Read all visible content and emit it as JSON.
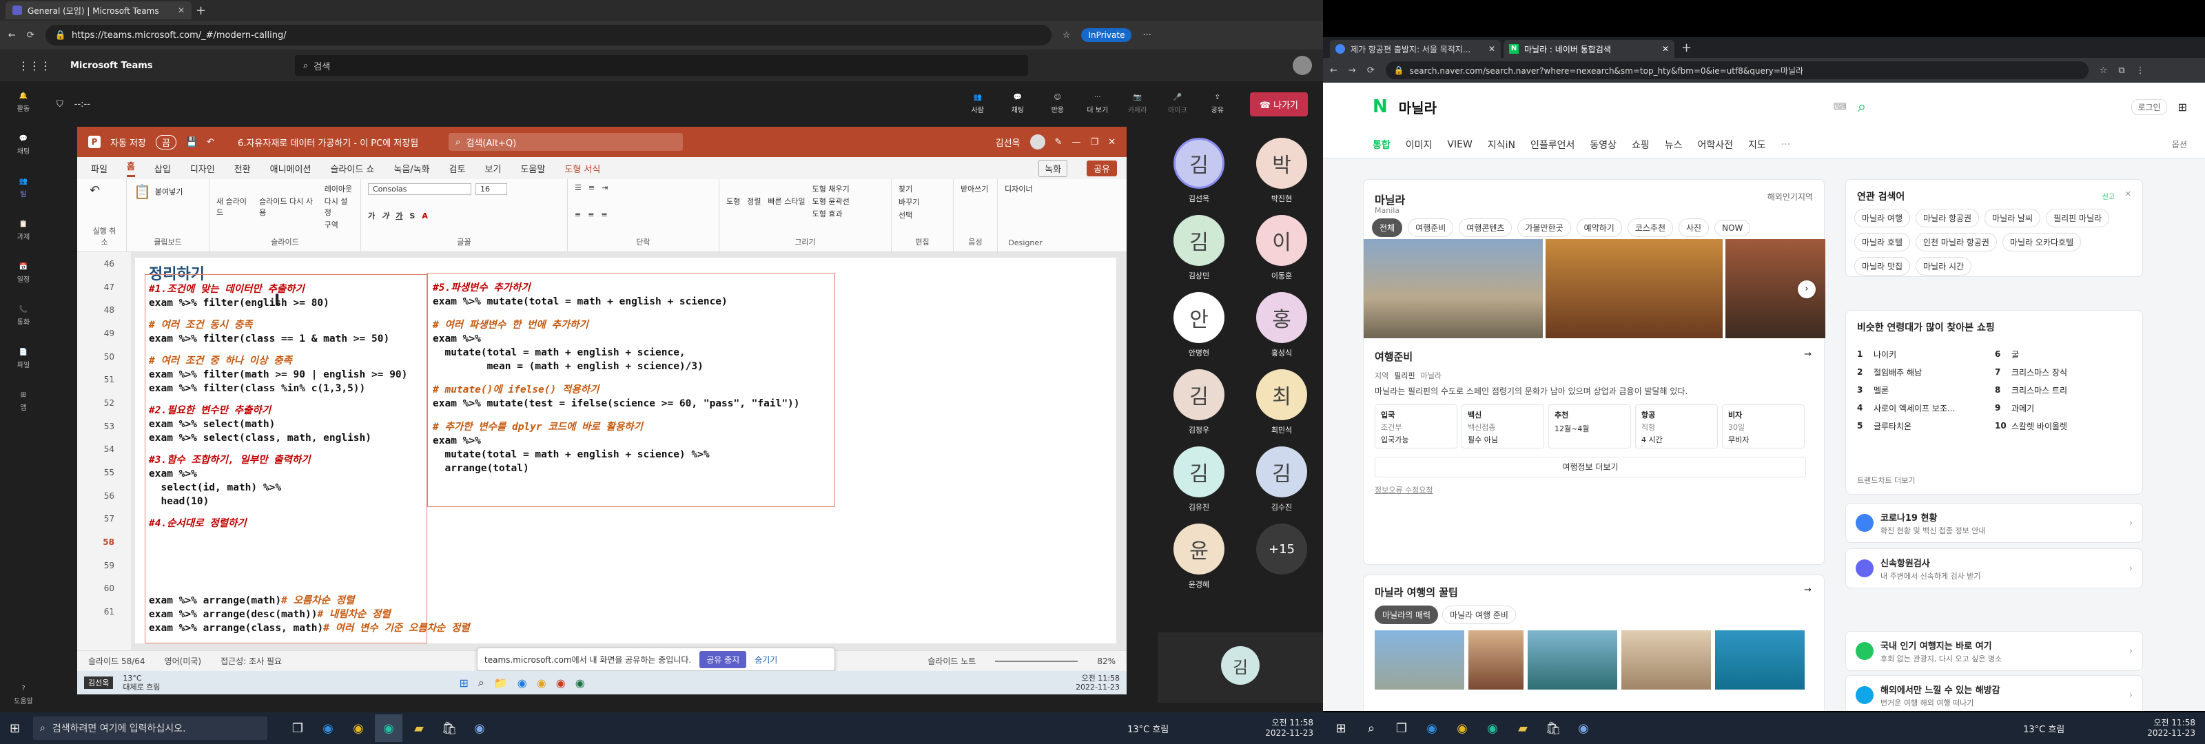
{
  "left": {
    "browser": {
      "tabs": [
        {
          "label": "General (모임) | Microsoft Teams"
        }
      ],
      "url": "https://teams.microsoft.com/_#/modern-calling/",
      "inprivate": "InPrivate"
    },
    "teams": {
      "app_name": "Microsoft Teams",
      "search_placeholder": "검색",
      "timer": "--:--",
      "rail": [
        "활동",
        "채팅",
        "팀",
        "과제",
        "일정",
        "통화",
        "파일",
        "앱",
        "도움말"
      ],
      "meeting_buttons": [
        "사람",
        "채팅",
        "반응",
        "더 보기",
        "카메라",
        "마이크",
        "공유"
      ],
      "leave_label": "나가기",
      "participants": [
        {
          "initial": "김",
          "name": "김선옥",
          "color": "#c5c9f2"
        },
        {
          "initial": "박",
          "name": "박진현",
          "color": "#f1d9cf"
        },
        {
          "initial": "김",
          "name": "김상민",
          "color": "#cfe9d4"
        },
        {
          "initial": "이",
          "name": "이동훈",
          "color": "#f6d3d6"
        },
        {
          "initial": "안",
          "name": "안명현",
          "color": "#ffffff"
        },
        {
          "initial": "홍",
          "name": "홍성식",
          "color": "#ecd2e8"
        },
        {
          "initial": "김",
          "name": "김정우",
          "color": "#eadad0"
        },
        {
          "initial": "최",
          "name": "최민석",
          "color": "#f4e2b9"
        },
        {
          "initial": "김",
          "name": "김유진",
          "color": "#cfeee9"
        },
        {
          "initial": "김",
          "name": "김수진",
          "color": "#cfd9ee"
        },
        {
          "initial": "윤",
          "name": "윤경혜",
          "color": "#f1dfc7"
        },
        {
          "initial": "+15",
          "name": "",
          "color": "#3a3a3a"
        }
      ],
      "self_initial": "김"
    },
    "ppt": {
      "autosave": "자동 저장",
      "autosave_state": "끔",
      "doc_title": "6.자유자재로 데이터 가공하기 - 이 PC에 저장됨",
      "search": "검색(Alt+Q)",
      "user": "김선옥",
      "menu": [
        "파일",
        "홈",
        "삽입",
        "디자인",
        "전환",
        "애니메이션",
        "슬라이드 쇼",
        "녹음/녹화",
        "검토",
        "보기",
        "도움말",
        "도형 서식"
      ],
      "record_label": "녹화",
      "share_label": "공유",
      "ribbon_groups": [
        "실행 취소",
        "클립보드",
        "슬라이드",
        "글꼴",
        "단락",
        "그리기",
        "편집",
        "음성",
        "Designer"
      ],
      "ribbon_items": {
        "paste": "붙여넣기",
        "new_slide": "새 슬라이드",
        "reuse_slide": "슬라이드 다시 사용",
        "layout": "레이아웃",
        "reset": "다시 설정",
        "section": "구역",
        "font": "Consolas",
        "size": "16",
        "shapes": "도형",
        "arrange": "정렬",
        "quick_styles": "빠른 스타일",
        "fill": "도형 채우기",
        "outline": "도형 윤곽선",
        "effects": "도형 효과",
        "find": "찾기",
        "replace": "바꾸기",
        "select": "선택",
        "dictate": "받아쓰기",
        "designer": "디자이너"
      },
      "thumb_numbers": [
        "46",
        "47",
        "48",
        "49",
        "50",
        "51",
        "52",
        "53",
        "54",
        "55",
        "56",
        "57",
        "58",
        "59",
        "60",
        "61"
      ],
      "active_thumb": "58",
      "slide": {
        "title": "정리하기",
        "left_blocks": [
          {
            "comment": "#1.조건에 맞는 데이터만 추출하기",
            "code": "exam %>% filter(english >= 80)",
            "red": true
          },
          {
            "comment": "# 여러 조건 동시 충족",
            "code": "exam %>% filter(class == 1 & math >= 50)",
            "red": false
          },
          {
            "comment": "# 여러 조건 중 하나 이상 충족",
            "code": "exam %>% filter(math >= 90 | english >= 90)\nexam %>% filter(class %in% c(1,3,5))",
            "red": false
          },
          {
            "comment": "#2.필요한 변수만 추출하기",
            "code": "exam %>% select(math)\nexam %>% select(class, math, english)",
            "red": true
          },
          {
            "comment": "#3.함수 조합하기, 일부만 출력하기",
            "code": "exam %>%\n  select(id, math) %>%\n  head(10)",
            "red": true
          },
          {
            "comment": "#4.순서대로 정렬하기",
            "code": "",
            "red": true
          }
        ],
        "sort_lines": [
          {
            "code": "exam %>% arrange(math)",
            "comment": " # 오름차순 정렬"
          },
          {
            "code": "exam %>% arrange(desc(math))",
            "comment": " # 내림차순 정렬"
          },
          {
            "code": "exam %>% arrange(class, math)",
            "comment": " # 여러 변수 기준 오름차순 정렬"
          }
        ],
        "right_blocks": [
          {
            "comment": "#5.파생변수 추가하기",
            "code": "exam %>% mutate(total = math + english + science)",
            "red": true
          },
          {
            "comment": "# 여러 파생변수 한 번에 추가하기",
            "code": "exam %>%\n  mutate(total = math + english + science,\n         mean = (math + english + science)/3)",
            "red": false
          },
          {
            "comment": "# mutate()에 ifelse() 적용하기",
            "code": "exam %>% mutate(test = ifelse(science >= 60, \"pass\", \"fail\"))",
            "red": false
          },
          {
            "comment": "# 추가한 변수를 dplyr 코드에 바로 활용하기",
            "code": "exam %>%\n  mutate(total = math + english + science) %>%\n  arrange(total)",
            "red": false
          }
        ]
      },
      "status": {
        "slide": "슬라이드 58/64",
        "lang": "영어(미국)",
        "access": "접근성: 조사 필요",
        "notes": "슬라이드 노트",
        "zoom": "82%"
      },
      "share_banner": {
        "text": "teams.microsoft.com에서 내 화면을 공유하는 중입니다.",
        "stop": "공유 중지",
        "hide": "숨기기"
      },
      "inner_taskbar": {
        "weather": "13°C",
        "weather_sub": "대체로 흐림",
        "time": "오전 11:58",
        "date": "2022-11-23",
        "tooltip": "김선옥"
      }
    },
    "taskbar": {
      "search": "검색하려면 여기에 입력하십시오.",
      "weather": "13°C 흐림",
      "time": "오전 11:58",
      "date": "2022-11-23"
    }
  },
  "right": {
    "browser": {
      "tabs": [
        {
          "label": "제가 항공편 출발지: 서울 목적지..."
        },
        {
          "label": "마닐라 : 네이버 통합검색"
        }
      ],
      "url": "search.naver.com/search.naver?where=nexearch&sm=top_hty&fbm=0&ie=utf8&query=마닐라"
    },
    "naver": {
      "query": "마닐라",
      "login": "로그인",
      "tabs": [
        "통합",
        "이미지",
        "VIEW",
        "지식iN",
        "인플루언서",
        "동영상",
        "쇼핑",
        "뉴스",
        "어학사전",
        "지도"
      ],
      "option": "옵션",
      "place": {
        "title": "마닐라",
        "subtitle": "Manila",
        "overseas": "해외인기지역",
        "subtabs": [
          "전체",
          "여행준비",
          "여행콘텐츠",
          "가볼만한곳",
          "예약하기",
          "코스추천",
          "사진",
          "NOW"
        ],
        "prep_title": "여행준비",
        "region_label": "지역",
        "country": "필리핀",
        "city": "마닐라",
        "desc": "마닐라는 필리핀의 수도로 스페인 점령기의 문화가 남아 있으며 상업과 금융이 발달해 있다.",
        "info": [
          {
            "label": "입국",
            "sub": "조건부",
            "value": "입국가능"
          },
          {
            "label": "백신",
            "sub": "백신접종",
            "value": "필수 아님"
          },
          {
            "label": "추천",
            "sub": "",
            "value": "12월~4월"
          },
          {
            "label": "항공",
            "sub": "직항",
            "value": "4 시간"
          },
          {
            "label": "비자",
            "sub": "30일",
            "value": "무비자"
          }
        ],
        "more_info": "여행정보 더보기",
        "correction": "정보오류 수정요청",
        "tips_title": "마닐라 여행의 꿀팁",
        "tips_chips": [
          "마닐라의 매력",
          "마닐라 여행 준비"
        ]
      },
      "related": {
        "title": "연관 검색어",
        "report": "신고",
        "keywords": [
          "마닐라 여행",
          "마닐라 항공권",
          "마닐라 날씨",
          "필리핀 마닐라",
          "마닐라 호텔",
          "인천 마닐라 항공권",
          "마닐라 오카다호텔",
          "마닐라 맛집",
          "마닐라 시간"
        ]
      },
      "shopping": {
        "title": "비슷한 연령대가 많이 찾아본 쇼핑",
        "items": [
          "나이키",
          "절임배추 해남",
          "멜론",
          "사로이 엑세이프 보조...",
          "글루타치온",
          "굴",
          "크리스마스 장식",
          "크리스마스 트리",
          "과메기",
          "스칼렛 바이올렛"
        ],
        "more": "트렌드차트 더보기"
      },
      "services": [
        {
          "title": "코로나19 현황",
          "sub": "확진 현황 및 백신 접종 정보 안내"
        },
        {
          "title": "신속항원검사",
          "sub": "내 주변에서 신속하게 검사 받기"
        },
        {
          "title": "국내 인기 여행지는 바로 여기",
          "sub": "후회 없는 관광지, 다시 오고 싶은 명소"
        },
        {
          "title": "해외에서만 느낄 수 있는 해방감",
          "sub": "번거운 여행 해외 여행 떠나기"
        }
      ]
    },
    "taskbar": {
      "weather": "13°C 흐림",
      "time": "오전 11:58",
      "date": "2022-11-23"
    }
  }
}
